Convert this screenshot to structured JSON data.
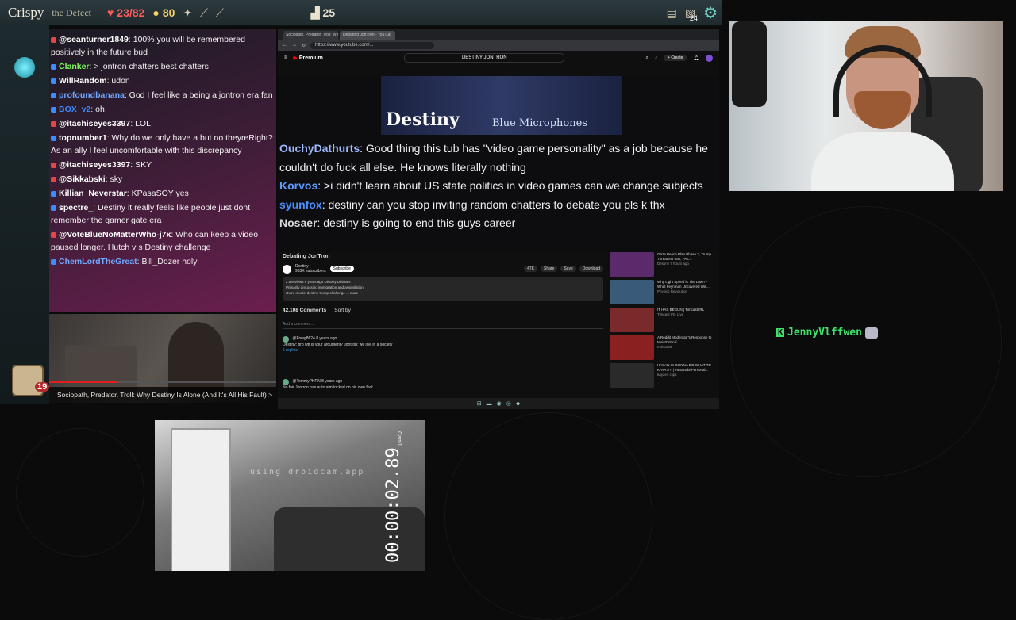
{
  "game": {
    "player_name": "Crispy",
    "player_title": "the Defect",
    "hp": "23/82",
    "gold": "80",
    "floor": "25",
    "deck_count": "24",
    "relic_count": "19"
  },
  "chat": {
    "messages": [
      {
        "user": "@seanturner1849",
        "text": ": 100% you will be remembered positively in the future bud",
        "color": "#ffffff"
      },
      {
        "user": "Clanker",
        "text": ": > jontron chatters best chatters",
        "color": "#7cff5a"
      },
      {
        "user": "WillRandom",
        "text": ": udon",
        "color": "#ffffff"
      },
      {
        "user": "profoundbanana",
        "text": ": God I feel like a  being a jontron era fan",
        "color": "#6fa8ff"
      },
      {
        "user": "BOX_v2",
        "text": ": oh",
        "color": "#3a8cff"
      },
      {
        "user": "@itachiseyes3397",
        "text": ": LOL",
        "color": "#ffffff"
      },
      {
        "user": "topnumber1",
        "text": ": Why do we only have a  but no theyreRight? As an ally I feel uncomfortable with this discrepancy",
        "color": "#ffffff"
      },
      {
        "user": "@itachiseyes3397",
        "text": ": SKY",
        "color": "#ffffff"
      },
      {
        "user": "@Sikkabski",
        "text": ":  sky",
        "color": "#ffffff"
      },
      {
        "user": "Killian_Neverstar",
        "text": ": KPasaSOY yes",
        "color": "#ffffff"
      },
      {
        "user": "spectre_",
        "text": ": Destiny it really feels like people just dont remember the gamer gate era",
        "color": "#ffffff"
      },
      {
        "user": "@VoteBlueNoMatterWho-j7x",
        "text": ": Who can keep a video paused longer. Hutch v s Destiny challenge",
        "color": "#ffffff"
      },
      {
        "user": "ChemLordTheGreat",
        "text": ": Bill_Dozer holy",
        "color": "#6fa8ff"
      }
    ],
    "caption": "Sociopath, Predator, Troll: Why Destiny Is Alone (And It's All His Fault)  >"
  },
  "browser": {
    "tabs": [
      "Sociopath, Predator, Troll: Wh",
      "Debating JonTron - YouTub"
    ],
    "url": "https://www.youtube.com/...",
    "search": "DESTINY JONTRON",
    "logo": "Premium",
    "create": "+ Create",
    "thumb_title": "Destiny",
    "thumb_sub": "Blue Microphones",
    "overlay": [
      {
        "user": "OuchyDathurts",
        "text": ": Good thing this tub has \"video game personality\" as a job because he couldn't do fuck all else. He knows literally nothing"
      },
      {
        "user": "Korvos",
        "text": ": >i didn't learn about US state politics in video games can we change subjects"
      },
      {
        "user": "syunfox",
        "text": ": destiny can you stop inviting random chatters to debate you pls k thx"
      },
      {
        "user": "Nosaer",
        "text": ": destiny is going to end this guys career"
      }
    ],
    "video_title": "Debating JonTron",
    "channel": "Destiny",
    "channel_subs": "933K subscribers",
    "subscribe": "Subscribe",
    "actions": [
      "47K",
      "Share",
      "Save",
      "Download"
    ],
    "desc_line1": "2.5M views  8 years ago  Destiny Debates",
    "desc_line2": "Primarily discussing immigration and assimilation.",
    "desc_line3": "Outro music: destiny-trump-challenge ... more",
    "comments_count": "42,108 Comments",
    "sort_by": "Sort by",
    "add_comment": "Add a comment...",
    "comments": [
      {
        "user": "@Fowg8624  8 years ago",
        "text": "Destiny: bro wtf is your argument? Jontron: we live in a society"
      },
      {
        "user": "@TommyPHRN  8 years ago",
        "text": "No fair Jontron has auto aim locked on his own foot"
      }
    ],
    "replies": "5 replies",
    "recs": [
      {
        "title": "Gaza Peace Plan Phase 2, Trump Threatens Iran, PAL...",
        "meta": "Destiny  7 hours ago",
        "color": "#5a2a6a"
      },
      {
        "title": "Why Light Speed is The LIMIT? What Feynman Uncovered Will...",
        "meta": "Physics Revolution",
        "color": "#3a5a7a"
      },
      {
        "title": "IT HAS BEGUN | Timcast IRL",
        "meta": "Timcast IRL  Live",
        "color": "#7a2a2a"
      },
      {
        "title": "A Reddit Moderator's Response to MoistCritical",
        "meta": "moist369",
        "color": "#8a2020"
      },
      {
        "title": "HASAN IS GONNA DO WHAT TO KAYA?!?! | Hasanabi Personal...",
        "meta": "kayzen clips",
        "color": "#2a2a2a"
      }
    ]
  },
  "overlay_user": "JennyVlffwen",
  "droidcam": {
    "watermark": "using droidcam.app",
    "timecode": "00:00:02.89",
    "cam_label": "Cam1"
  }
}
